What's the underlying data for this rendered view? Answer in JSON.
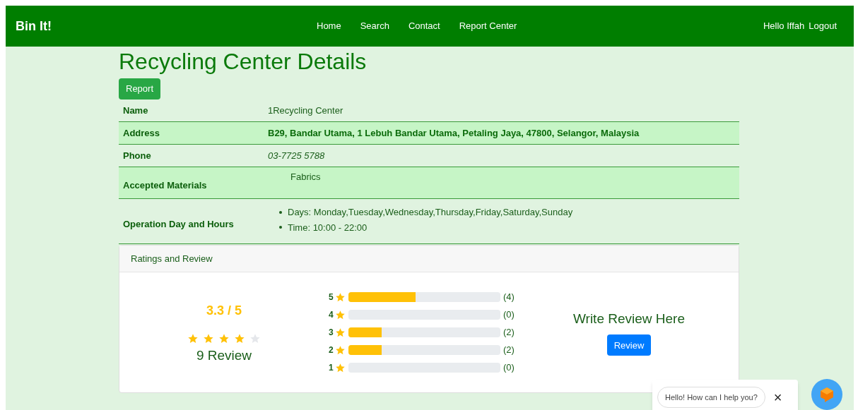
{
  "navbar": {
    "brand": "Bin It!",
    "links": [
      "Home",
      "Search",
      "Contact",
      "Report Center"
    ],
    "greeting": "Hello Iffah",
    "logout": "Logout"
  },
  "page_title": "Recycling Center Details",
  "report_button": "Report",
  "details": [
    {
      "label": "Name",
      "kind": "plain",
      "value": "1Recycling Center"
    },
    {
      "label": "Address",
      "kind": "bold",
      "value": "B29, Bandar Utama, 1 Lebuh Bandar Utama, Petaling Jaya, 47800, Selangor, Malaysia"
    },
    {
      "label": "Phone",
      "kind": "italic",
      "value": "03-7725 5788"
    },
    {
      "label": "Accepted Materials",
      "kind": "list",
      "items": [
        "Fabrics"
      ]
    },
    {
      "label": "Operation Day and Hours",
      "kind": "bullets",
      "items": [
        "Days: Monday,Tuesday,Wednesday,Thursday,Friday,Saturday,Sunday",
        "Time: 10:00 - 22:00"
      ]
    }
  ],
  "ratings": {
    "header": "Ratings and Review",
    "score": "3.3 / 5",
    "stars": 4,
    "review_count": "9 Review",
    "breakdown": [
      {
        "label": "5",
        "level": 0.44,
        "count": "(4)"
      },
      {
        "label": "4",
        "count": "(0)"
      },
      {
        "label": "3",
        "level": 0.22,
        "count": "(2)"
      },
      {
        "label": "2",
        "level": 0.22,
        "count": "(2)"
      },
      {
        "label": "1",
        "count": "(0)"
      }
    ],
    "write_heading": "Write Review Here",
    "review_button": "Review"
  },
  "chat": {
    "message": "Hello! How can I help you?",
    "close": "×"
  }
}
